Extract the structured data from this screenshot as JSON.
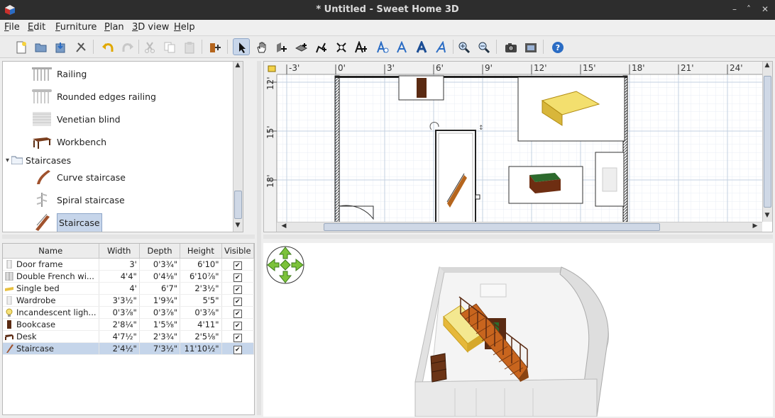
{
  "window": {
    "title": "* Untitled - Sweet Home 3D",
    "controls": [
      "–",
      "˄",
      "✕"
    ]
  },
  "menu": [
    {
      "key": "F",
      "rest": "ile"
    },
    {
      "key": "E",
      "rest": "dit"
    },
    {
      "key": "F",
      "rest": "urniture"
    },
    {
      "key": "P",
      "rest": "lan"
    },
    {
      "key": "3",
      "rest": "D view"
    },
    {
      "key": "H",
      "rest": "elp"
    }
  ],
  "toolbar": {
    "icons": [
      "new-home-icon",
      "open-icon",
      "save-icon",
      "preferences-icon",
      "undo-icon",
      "redo-icon",
      "cut-icon",
      "copy-icon",
      "paste-icon",
      "add-furniture-icon",
      "select-icon",
      "pan-icon",
      "create-walls-icon",
      "create-rooms-icon",
      "create-polylines-icon",
      "create-dimensions-icon",
      "add-text-icon",
      "text-style-icon",
      "increase-text-icon",
      "decrease-text-icon",
      "bold-text-icon",
      "italic-text-icon",
      "zoom-in-icon",
      "zoom-out-icon",
      "create-photo-icon",
      "create-video-icon",
      "help-icon"
    ],
    "selected_tool": "select-icon"
  },
  "catalog": {
    "items": [
      {
        "label": "Railing",
        "indent": 1
      },
      {
        "label": "Rounded edges railing",
        "indent": 1
      },
      {
        "label": "Venetian blind",
        "indent": 1
      },
      {
        "label": "Workbench",
        "indent": 1
      },
      {
        "label": "Staircases",
        "indent": 0,
        "category": true
      },
      {
        "label": "Curve staircase",
        "indent": 1
      },
      {
        "label": "Spiral staircase",
        "indent": 1
      },
      {
        "label": "Staircase",
        "indent": 1,
        "selected": true
      }
    ]
  },
  "furniture_table": {
    "columns": [
      "Name",
      "Width",
      "Depth",
      "Height",
      "Visible"
    ],
    "rows": [
      {
        "name": "Door frame",
        "width": "3'",
        "depth": "0'3¾\"",
        "height": "6'10\"",
        "visible": true
      },
      {
        "name": "Double French wi...",
        "width": "4'4\"",
        "depth": "0'4⅛\"",
        "height": "6'10⅞\"",
        "visible": true
      },
      {
        "name": "Single bed",
        "width": "4'",
        "depth": "6'7\"",
        "height": "2'3½\"",
        "visible": true
      },
      {
        "name": "Wardrobe",
        "width": "3'3½\"",
        "depth": "1'9¾\"",
        "height": "5'5\"",
        "visible": true
      },
      {
        "name": "Incandescent ligh...",
        "width": "0'3⅞\"",
        "depth": "0'3⅞\"",
        "height": "0'3⅞\"",
        "visible": true
      },
      {
        "name": "Bookcase",
        "width": "2'8¼\"",
        "depth": "1'5⅝\"",
        "height": "4'11\"",
        "visible": true
      },
      {
        "name": "Desk",
        "width": "4'7½\"",
        "depth": "2'3¾\"",
        "height": "2'5⅛\"",
        "visible": true
      },
      {
        "name": "Staircase",
        "width": "2'4½\"",
        "depth": "7'3½\"",
        "height": "11'10½\"",
        "visible": true,
        "selected": true
      }
    ]
  },
  "plan": {
    "ruler_x": [
      "-3'",
      "0'",
      "3'",
      "6'",
      "9'",
      "12'",
      "15'",
      "18'",
      "21'",
      "24'"
    ],
    "ruler_y": [
      "12'",
      "15'",
      "18'"
    ]
  }
}
